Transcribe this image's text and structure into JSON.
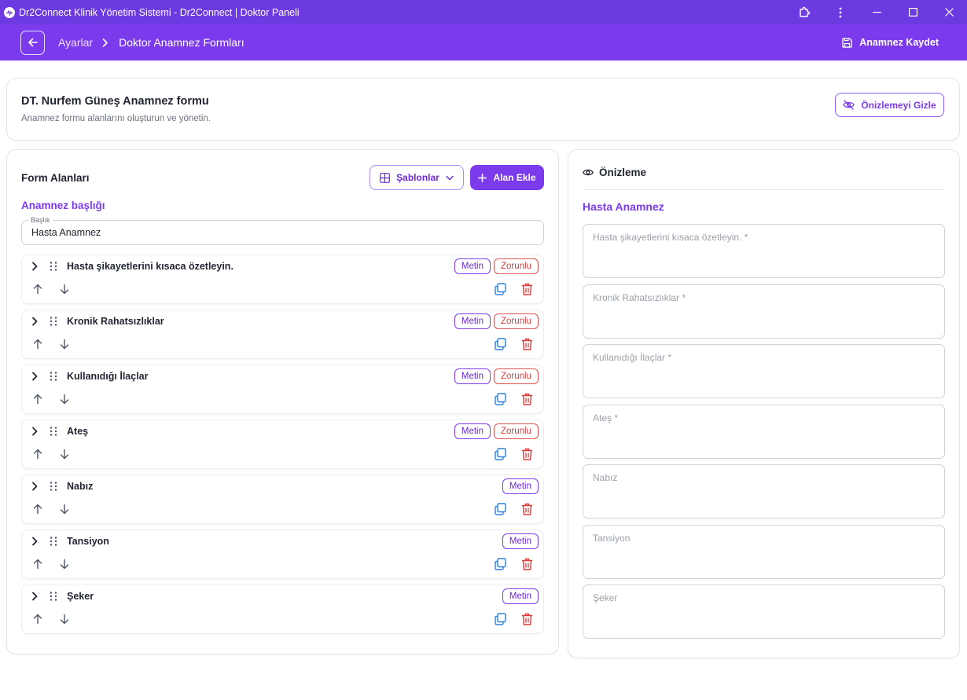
{
  "window": {
    "title": "Dr2Connect Klinik Yönetim Sistemi - Dr2Connect | Doktor Paneli"
  },
  "header": {
    "breadcrumb": [
      "Ayarlar",
      "Doktor Anamnez Formları"
    ],
    "save_label": "Anamnez Kaydet"
  },
  "top": {
    "title": "DT. Nurfem Güneş Anamnez formu",
    "subtitle": "Anamnez formu alanlarını oluşturun ve yönetin.",
    "toggle_preview_label": "Önizlemeyi Gizle"
  },
  "editor": {
    "section_title": "Form Alanları",
    "templates_label": "Şablonlar",
    "add_field_label": "Alan Ekle",
    "form_heading": "Anamnez başlığı",
    "title_field_label": "Başlık",
    "title_value": "Hasta Anamnez",
    "fields": [
      {
        "label": "Hasta şikayetlerini kısaca özetleyin.",
        "type": "Metin",
        "required": "Zorunlu"
      },
      {
        "label": "Kronik Rahatsızlıklar",
        "type": "Metin",
        "required": "Zorunlu"
      },
      {
        "label": "Kullanıdığı İlaçlar",
        "type": "Metin",
        "required": "Zorunlu"
      },
      {
        "label": "Ateş",
        "type": "Metin",
        "required": "Zorunlu"
      },
      {
        "label": "Nabız",
        "type": "Metin",
        "required": ""
      },
      {
        "label": "Tansiyon",
        "type": "Metin",
        "required": ""
      },
      {
        "label": "Şeker",
        "type": "Metin",
        "required": ""
      }
    ]
  },
  "preview": {
    "section_title": "Önizleme",
    "form_title": "Hasta Anamnez",
    "inputs": [
      "Hasta şikayetlerini kısaca özetleyin. *",
      "Kronik Rahatsızlıklar *",
      "Kullanıdığı İlaçlar *",
      "Ateş *",
      "Nabız",
      "Tansiyon",
      "Şeker"
    ]
  },
  "colors": {
    "primary": "#7c3aed",
    "titlebar": "#6d39e0",
    "danger": "#d93b3b",
    "copy_icon": "#2f7fd8"
  }
}
